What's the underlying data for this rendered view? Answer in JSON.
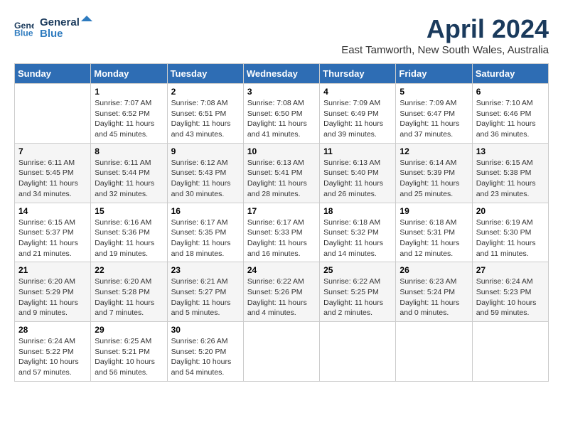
{
  "logo": {
    "line1": "General",
    "line2": "Blue"
  },
  "title": "April 2024",
  "subtitle": "East Tamworth, New South Wales, Australia",
  "weekdays": [
    "Sunday",
    "Monday",
    "Tuesday",
    "Wednesday",
    "Thursday",
    "Friday",
    "Saturday"
  ],
  "weeks": [
    [
      {
        "day": "",
        "detail": ""
      },
      {
        "day": "1",
        "detail": "Sunrise: 7:07 AM\nSunset: 6:52 PM\nDaylight: 11 hours\nand 45 minutes."
      },
      {
        "day": "2",
        "detail": "Sunrise: 7:08 AM\nSunset: 6:51 PM\nDaylight: 11 hours\nand 43 minutes."
      },
      {
        "day": "3",
        "detail": "Sunrise: 7:08 AM\nSunset: 6:50 PM\nDaylight: 11 hours\nand 41 minutes."
      },
      {
        "day": "4",
        "detail": "Sunrise: 7:09 AM\nSunset: 6:49 PM\nDaylight: 11 hours\nand 39 minutes."
      },
      {
        "day": "5",
        "detail": "Sunrise: 7:09 AM\nSunset: 6:47 PM\nDaylight: 11 hours\nand 37 minutes."
      },
      {
        "day": "6",
        "detail": "Sunrise: 7:10 AM\nSunset: 6:46 PM\nDaylight: 11 hours\nand 36 minutes."
      }
    ],
    [
      {
        "day": "7",
        "detail": "Sunrise: 6:11 AM\nSunset: 5:45 PM\nDaylight: 11 hours\nand 34 minutes."
      },
      {
        "day": "8",
        "detail": "Sunrise: 6:11 AM\nSunset: 5:44 PM\nDaylight: 11 hours\nand 32 minutes."
      },
      {
        "day": "9",
        "detail": "Sunrise: 6:12 AM\nSunset: 5:43 PM\nDaylight: 11 hours\nand 30 minutes."
      },
      {
        "day": "10",
        "detail": "Sunrise: 6:13 AM\nSunset: 5:41 PM\nDaylight: 11 hours\nand 28 minutes."
      },
      {
        "day": "11",
        "detail": "Sunrise: 6:13 AM\nSunset: 5:40 PM\nDaylight: 11 hours\nand 26 minutes."
      },
      {
        "day": "12",
        "detail": "Sunrise: 6:14 AM\nSunset: 5:39 PM\nDaylight: 11 hours\nand 25 minutes."
      },
      {
        "day": "13",
        "detail": "Sunrise: 6:15 AM\nSunset: 5:38 PM\nDaylight: 11 hours\nand 23 minutes."
      }
    ],
    [
      {
        "day": "14",
        "detail": "Sunrise: 6:15 AM\nSunset: 5:37 PM\nDaylight: 11 hours\nand 21 minutes."
      },
      {
        "day": "15",
        "detail": "Sunrise: 6:16 AM\nSunset: 5:36 PM\nDaylight: 11 hours\nand 19 minutes."
      },
      {
        "day": "16",
        "detail": "Sunrise: 6:17 AM\nSunset: 5:35 PM\nDaylight: 11 hours\nand 18 minutes."
      },
      {
        "day": "17",
        "detail": "Sunrise: 6:17 AM\nSunset: 5:33 PM\nDaylight: 11 hours\nand 16 minutes."
      },
      {
        "day": "18",
        "detail": "Sunrise: 6:18 AM\nSunset: 5:32 PM\nDaylight: 11 hours\nand 14 minutes."
      },
      {
        "day": "19",
        "detail": "Sunrise: 6:18 AM\nSunset: 5:31 PM\nDaylight: 11 hours\nand 12 minutes."
      },
      {
        "day": "20",
        "detail": "Sunrise: 6:19 AM\nSunset: 5:30 PM\nDaylight: 11 hours\nand 11 minutes."
      }
    ],
    [
      {
        "day": "21",
        "detail": "Sunrise: 6:20 AM\nSunset: 5:29 PM\nDaylight: 11 hours\nand 9 minutes."
      },
      {
        "day": "22",
        "detail": "Sunrise: 6:20 AM\nSunset: 5:28 PM\nDaylight: 11 hours\nand 7 minutes."
      },
      {
        "day": "23",
        "detail": "Sunrise: 6:21 AM\nSunset: 5:27 PM\nDaylight: 11 hours\nand 5 minutes."
      },
      {
        "day": "24",
        "detail": "Sunrise: 6:22 AM\nSunset: 5:26 PM\nDaylight: 11 hours\nand 4 minutes."
      },
      {
        "day": "25",
        "detail": "Sunrise: 6:22 AM\nSunset: 5:25 PM\nDaylight: 11 hours\nand 2 minutes."
      },
      {
        "day": "26",
        "detail": "Sunrise: 6:23 AM\nSunset: 5:24 PM\nDaylight: 11 hours\nand 0 minutes."
      },
      {
        "day": "27",
        "detail": "Sunrise: 6:24 AM\nSunset: 5:23 PM\nDaylight: 10 hours\nand 59 minutes."
      }
    ],
    [
      {
        "day": "28",
        "detail": "Sunrise: 6:24 AM\nSunset: 5:22 PM\nDaylight: 10 hours\nand 57 minutes."
      },
      {
        "day": "29",
        "detail": "Sunrise: 6:25 AM\nSunset: 5:21 PM\nDaylight: 10 hours\nand 56 minutes."
      },
      {
        "day": "30",
        "detail": "Sunrise: 6:26 AM\nSunset: 5:20 PM\nDaylight: 10 hours\nand 54 minutes."
      },
      {
        "day": "",
        "detail": ""
      },
      {
        "day": "",
        "detail": ""
      },
      {
        "day": "",
        "detail": ""
      },
      {
        "day": "",
        "detail": ""
      }
    ]
  ]
}
